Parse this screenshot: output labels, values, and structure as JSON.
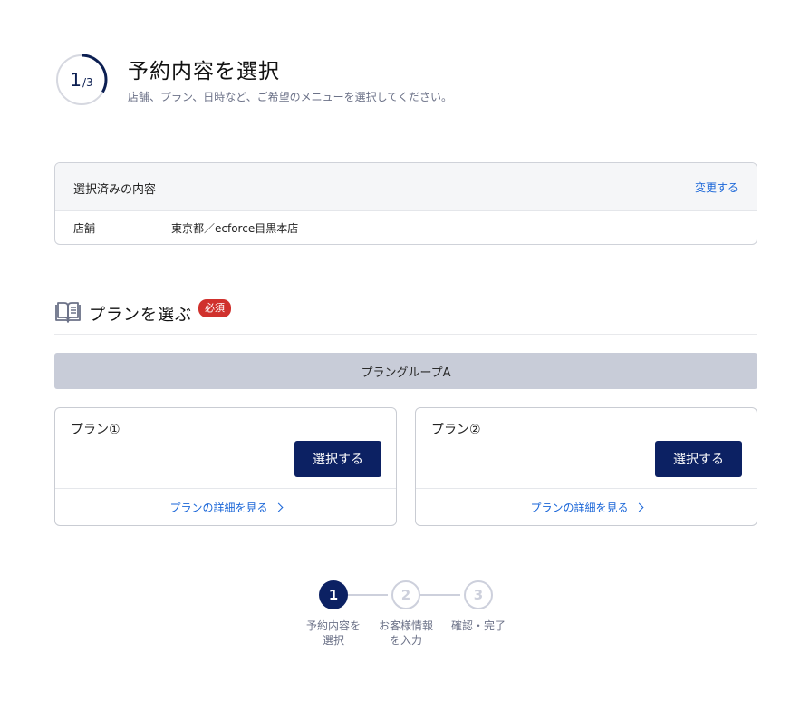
{
  "header": {
    "step_current": "1",
    "step_total": "/3",
    "progress_fraction": 0.333,
    "title": "予約内容を選択",
    "subtitle": "店舗、プラン、日時など、ご希望のメニューを選択してください。"
  },
  "selected": {
    "title": "選択済みの内容",
    "change_label": "変更する",
    "rows": [
      {
        "key": "店舗",
        "value": "東京都／ecforce目黒本店"
      }
    ]
  },
  "plan_section": {
    "icon": "open-book-icon",
    "title": "プランを選ぶ",
    "required_badge": "必須",
    "group_label": "プラングループA",
    "plans": [
      {
        "name": "プラン①",
        "select_label": "選択する",
        "detail_label": "プランの詳細を見る"
      },
      {
        "name": "プラン②",
        "select_label": "選択する",
        "detail_label": "プランの詳細を見る"
      }
    ]
  },
  "stepper": {
    "steps": [
      {
        "number": "1",
        "label_line1": "予約内容を",
        "label_line2": "選択",
        "state": "active"
      },
      {
        "number": "2",
        "label_line1": "お客様情報",
        "label_line2": "を入力",
        "state": "inactive"
      },
      {
        "number": "3",
        "label_line1": "確認・完了",
        "label_line2": "",
        "state": "inactive"
      }
    ]
  },
  "colors": {
    "primary": "#0c2163",
    "link": "#1a66d8",
    "required": "#d0312d",
    "group_bar": "#c8ccd8"
  }
}
